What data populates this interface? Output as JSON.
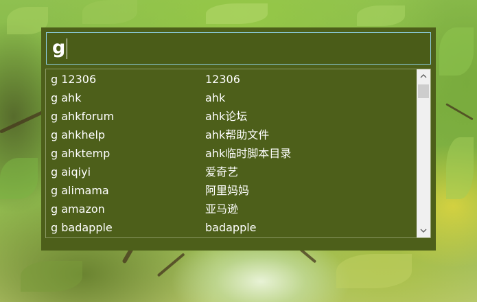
{
  "search": {
    "value": "g"
  },
  "results": [
    {
      "key": "g 12306",
      "desc": "12306"
    },
    {
      "key": "g ahk",
      "desc": "ahk"
    },
    {
      "key": "g ahkforum",
      "desc": "ahk论坛"
    },
    {
      "key": "g ahkhelp",
      "desc": "ahk帮助文件"
    },
    {
      "key": "g ahktemp",
      "desc": "ahk临时脚本目录"
    },
    {
      "key": "g aiqiyi",
      "desc": "爱奇艺"
    },
    {
      "key": "g alimama",
      "desc": "阿里妈妈"
    },
    {
      "key": "g amazon",
      "desc": "亚马逊"
    },
    {
      "key": "g badapple",
      "desc": "badapple"
    }
  ],
  "scrollbar": {
    "up_icon": "chevron-up-icon",
    "down_icon": "chevron-down-icon",
    "position": 0
  },
  "colors": {
    "panel": "#4d5f1a",
    "focus_border": "#8fd2e8",
    "text": "#ffffff"
  }
}
